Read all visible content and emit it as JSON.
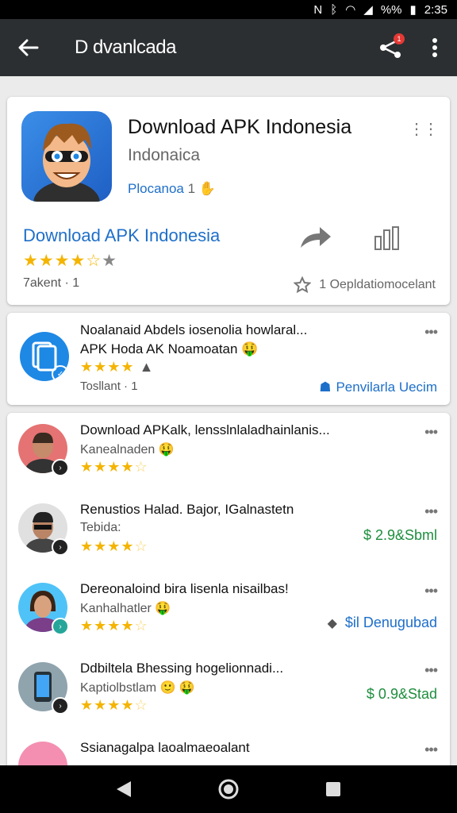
{
  "status_bar": {
    "time": "2:35",
    "battery": "%%"
  },
  "app_bar": {
    "title": "D dvanlcada",
    "share_badge": "1"
  },
  "hero": {
    "title": "Download APK Indonesia",
    "subtitle": "Indonaica",
    "meta_link": "Plocanoa",
    "meta_count": "1",
    "link": "Download  APK Indonesia",
    "stars": "★★★★",
    "stars_half": "☆",
    "stars_empty": "★",
    "count": "7akent · 1",
    "action": "1 Oepldatiomocelant"
  },
  "feature": {
    "title": "Noalanaid Abdels iosenolia howlaral...",
    "subtitle": "APK Hoda AK Noamoatan 🤑",
    "stars": "★★★★",
    "count": "Tosllant · 1",
    "action": "Penvilarla Uecim"
  },
  "list": [
    {
      "title": "Download APKalk, lensslnlaladhainlanis...",
      "subtitle": "Kanealnaden 🤑",
      "stars": "★★★★",
      "stars_empty": "☆",
      "badge": "›"
    },
    {
      "title": "Renustios Halad. Bajor, IGalnastetn",
      "subtitle": "Tebida:",
      "stars": "★★★★",
      "stars_empty": "☆",
      "price": "$ 2.9&Sbml",
      "badge": "›"
    },
    {
      "title": "Dereonaloind bira lisenla nisailbas!",
      "subtitle": "Kanhalhatler 🤑",
      "stars": "★★★★",
      "stars_empty": "☆",
      "action": "$il  Denugubad",
      "badge": "›"
    },
    {
      "title": "Ddbiltela Bhessing hogelionnadi...",
      "subtitle": "Kaptiolbstlam 🙂          🤑",
      "stars": "★★★★",
      "stars_empty": "☆",
      "price": "$ 0.9&Stad",
      "badge": "›"
    },
    {
      "title": "Ssianagalpa laoalmaeoalant",
      "subtitle": ""
    }
  ],
  "colors": {
    "appbar": "#2b2f31",
    "accent": "#1e6fc9",
    "price": "#1e8e3e",
    "star": "#f4b400"
  }
}
